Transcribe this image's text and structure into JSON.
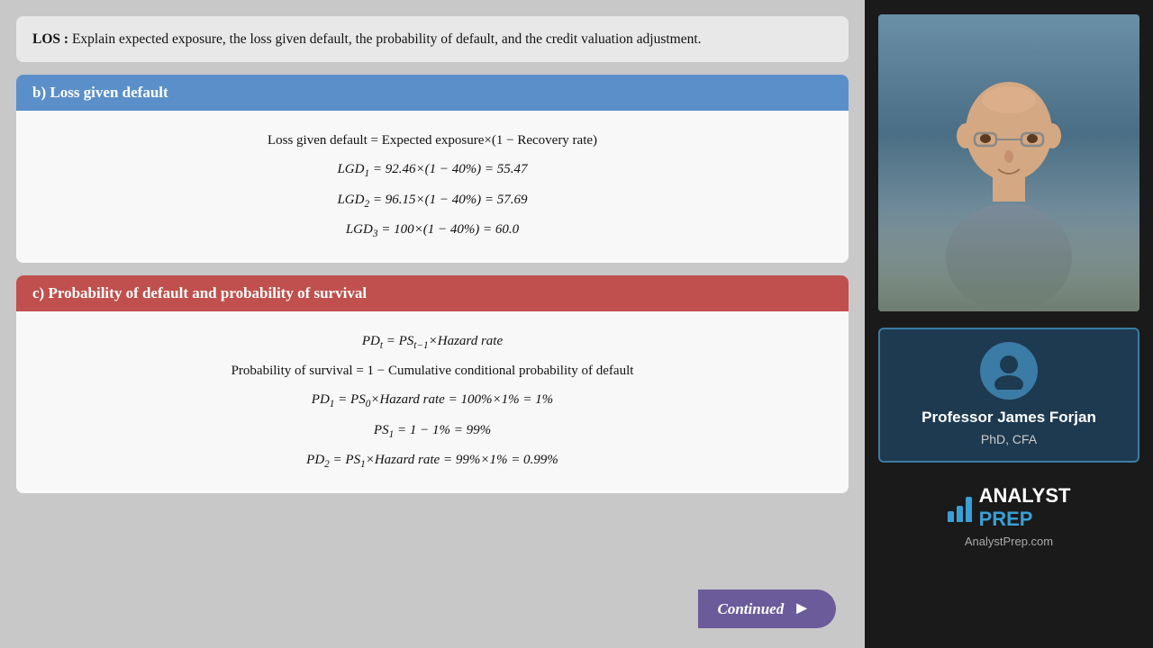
{
  "los": {
    "label": "LOS :",
    "text": " Explain expected exposure, the loss given default, the probability of default, and the credit valuation adjustment."
  },
  "section_b": {
    "header": "b)   Loss given default",
    "formula_main": "Loss given default = Expected exposure×(1 − Recovery rate)",
    "formulas": [
      "LGD₁ = 92.46×(1 − 40%) = 55.47",
      "LGD₂ = 96.15×(1 − 40%) = 57.69",
      "LGD₃ = 100×(1 − 40%) = 60.0"
    ]
  },
  "section_c": {
    "header": "c)   Probability of default and probability of survival",
    "formula_main": "PDₜ = PSₜ₋₁×Hazard rate",
    "formula_survival": "Probability of survival = 1 − Cumulative conditional probability of default",
    "formulas": [
      "PD₁ = PS₀×Hazard rate = 100%×1% = 1%",
      "PS₁ = 1 − 1% = 99%",
      "PD₂ = PS₁×Hazard rate = 99%×1% = 0.99%"
    ]
  },
  "continued_btn": "Continued",
  "professor": {
    "name": "Professor James Forjan",
    "title": "PhD, CFA"
  },
  "logo": {
    "text_analyst": "ANALYST",
    "text_prep": "PREP",
    "url": "AnalystPrep.com"
  }
}
